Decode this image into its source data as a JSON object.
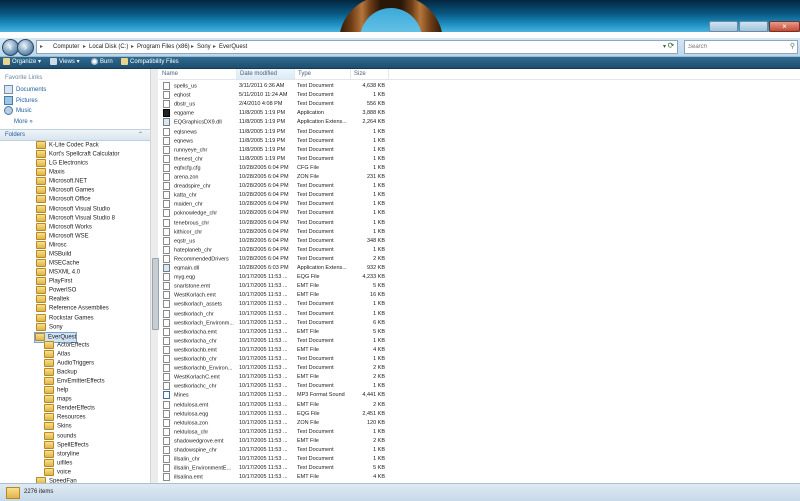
{
  "address": {
    "crumbs": [
      "Computer",
      "Local Disk (C:)",
      "Program Files (x86)",
      "Sony",
      "EverQuest"
    ],
    "search_placeholder": "Search"
  },
  "toolbar": {
    "organize": "Organize",
    "views": "Views",
    "burn": "Burn",
    "compat": "Compatibility Files"
  },
  "favorites": {
    "title": "Favorite Links",
    "items": [
      "Documents",
      "Pictures",
      "Music"
    ],
    "more": "More"
  },
  "folders": {
    "title": "Folders",
    "items": [
      "K-Lite Codec Pack",
      "Kort's Spellcraft Calculator",
      "LG Electronics",
      "Maxis",
      "Microsoft.NET",
      "Microsoft Games",
      "Microsoft Office",
      "Microsoft Visual Studio",
      "Microsoft Visual Studio 8",
      "Microsoft Works",
      "Microsoft WSE",
      "Mirosc",
      "MSBuild",
      "MSECache",
      "MSXML 4.0",
      "PlayFirst",
      "PowerISO",
      "Realtek",
      "Reference Assemblies",
      "Rockstar Games",
      "Sony",
      "EverQuest",
      "ActorEffects",
      "Atlas",
      "AudioTriggers",
      "Backup",
      "EnvEmitterEffects",
      "help",
      "maps",
      "RenderEffects",
      "Resources",
      "Skins",
      "sounds",
      "SpellEffects",
      "storyline",
      "uifiles",
      "voice",
      "SpeedFan"
    ]
  },
  "columns": {
    "name": "Name",
    "date": "Date modified",
    "type": "Type",
    "size": "Size"
  },
  "files": [
    {
      "name": "spells_us",
      "date": "3/11/2011 6:36 AM",
      "type": "Text Document",
      "size": "4,638 KB",
      "icon": "doc"
    },
    {
      "name": "eqhost",
      "date": "5/11/2010 11:24 AM",
      "type": "Text Document",
      "size": "1 KB",
      "icon": "doc"
    },
    {
      "name": "dbstr_us",
      "date": "2/4/2010 4:08 PM",
      "type": "Text Document",
      "size": "556 KB",
      "icon": "doc"
    },
    {
      "name": "eqgame",
      "date": "11/8/2005 1:19 PM",
      "type": "Application",
      "size": "3,888 KB",
      "icon": "app"
    },
    {
      "name": "EQGraphicsDX9.dll",
      "date": "11/8/2005 1:19 PM",
      "type": "Application Extens...",
      "size": "2,264 KB",
      "icon": "dll"
    },
    {
      "name": "eqlsnews",
      "date": "11/8/2005 1:19 PM",
      "type": "Text Document",
      "size": "1 KB",
      "icon": "doc"
    },
    {
      "name": "eqnews",
      "date": "11/8/2005 1:19 PM",
      "type": "Text Document",
      "size": "1 KB",
      "icon": "doc"
    },
    {
      "name": "runnyeye_chr",
      "date": "11/8/2005 1:19 PM",
      "type": "Text Document",
      "size": "1 KB",
      "icon": "doc"
    },
    {
      "name": "thenest_chr",
      "date": "11/8/2005 1:19 PM",
      "type": "Text Document",
      "size": "1 KB",
      "icon": "doc"
    },
    {
      "name": "eqfxcfg.cfg",
      "date": "10/28/2005 6:04 PM",
      "type": "CFG File",
      "size": "1 KB",
      "icon": "doc"
    },
    {
      "name": "arena.zon",
      "date": "10/28/2005 6:04 PM",
      "type": "ZON File",
      "size": "231 KB",
      "icon": "doc"
    },
    {
      "name": "dreadspire_chr",
      "date": "10/28/2005 6:04 PM",
      "type": "Text Document",
      "size": "1 KB",
      "icon": "doc"
    },
    {
      "name": "katta_chr",
      "date": "10/28/2005 6:04 PM",
      "type": "Text Document",
      "size": "1 KB",
      "icon": "doc"
    },
    {
      "name": "maiden_chr",
      "date": "10/28/2005 6:04 PM",
      "type": "Text Document",
      "size": "1 KB",
      "icon": "doc"
    },
    {
      "name": "poknowledge_chr",
      "date": "10/28/2005 6:04 PM",
      "type": "Text Document",
      "size": "1 KB",
      "icon": "doc"
    },
    {
      "name": "tenebrous_chr",
      "date": "10/28/2005 6:04 PM",
      "type": "Text Document",
      "size": "1 KB",
      "icon": "doc"
    },
    {
      "name": "kithicor_chr",
      "date": "10/28/2005 6:04 PM",
      "type": "Text Document",
      "size": "1 KB",
      "icon": "doc"
    },
    {
      "name": "eqstr_us",
      "date": "10/28/2005 6:04 PM",
      "type": "Text Document",
      "size": "348 KB",
      "icon": "doc"
    },
    {
      "name": "hateplaneb_chr",
      "date": "10/28/2005 6:04 PM",
      "type": "Text Document",
      "size": "1 KB",
      "icon": "doc"
    },
    {
      "name": "RecommendedDrivers",
      "date": "10/28/2005 6:04 PM",
      "type": "Text Document",
      "size": "2 KB",
      "icon": "doc"
    },
    {
      "name": "eqmain.dll",
      "date": "10/28/2005 6:03 PM",
      "type": "Application Extens...",
      "size": "932 KB",
      "icon": "dll"
    },
    {
      "name": "myg.eqg",
      "date": "10/17/2005 11:53 ...",
      "type": "EQG File",
      "size": "4,233 KB",
      "icon": "doc"
    },
    {
      "name": "snarlstone.emt",
      "date": "10/17/2005 11:53 ...",
      "type": "EMT File",
      "size": "5 KB",
      "icon": "doc"
    },
    {
      "name": "WestKorlach.emt",
      "date": "10/17/2005 11:53 ...",
      "type": "EMT File",
      "size": "16 KB",
      "icon": "doc"
    },
    {
      "name": "westkorlach_assets",
      "date": "10/17/2005 11:53 ...",
      "type": "Text Document",
      "size": "1 KB",
      "icon": "doc"
    },
    {
      "name": "westkorlach_chr",
      "date": "10/17/2005 11:53 ...",
      "type": "Text Document",
      "size": "1 KB",
      "icon": "doc"
    },
    {
      "name": "westkorlach_Environm...",
      "date": "10/17/2005 11:53 ...",
      "type": "Text Document",
      "size": "6 KB",
      "icon": "doc"
    },
    {
      "name": "westkorlacha.emt",
      "date": "10/17/2005 11:53 ...",
      "type": "EMT File",
      "size": "5 KB",
      "icon": "doc"
    },
    {
      "name": "westkorlacha_chr",
      "date": "10/17/2005 11:53 ...",
      "type": "Text Document",
      "size": "1 KB",
      "icon": "doc"
    },
    {
      "name": "westkorlachb.emt",
      "date": "10/17/2005 11:53 ...",
      "type": "EMT File",
      "size": "4 KB",
      "icon": "doc"
    },
    {
      "name": "westkorlachb_chr",
      "date": "10/17/2005 11:53 ...",
      "type": "Text Document",
      "size": "1 KB",
      "icon": "doc"
    },
    {
      "name": "westkorlachb_Environ...",
      "date": "10/17/2005 11:53 ...",
      "type": "Text Document",
      "size": "2 KB",
      "icon": "doc"
    },
    {
      "name": "WestKorlachC.emt",
      "date": "10/17/2005 11:53 ...",
      "type": "EMT File",
      "size": "2 KB",
      "icon": "doc"
    },
    {
      "name": "westkorlachc_chr",
      "date": "10/17/2005 11:53 ...",
      "type": "Text Document",
      "size": "1 KB",
      "icon": "doc"
    },
    {
      "name": "Mines",
      "date": "10/17/2005 11:53 ...",
      "type": "MP3 Format Sound",
      "size": "4,441 KB",
      "icon": "snd"
    },
    {
      "name": "nektulosa.emt",
      "date": "10/17/2005 11:53 ...",
      "type": "EMT File",
      "size": "2 KB",
      "icon": "doc"
    },
    {
      "name": "nektulosa.eqg",
      "date": "10/17/2005 11:53 ...",
      "type": "EQG File",
      "size": "2,451 KB",
      "icon": "doc"
    },
    {
      "name": "nektulosa.zon",
      "date": "10/17/2005 11:53 ...",
      "type": "ZON File",
      "size": "120 KB",
      "icon": "doc"
    },
    {
      "name": "nektulosa_chr",
      "date": "10/17/2005 11:53 ...",
      "type": "Text Document",
      "size": "1 KB",
      "icon": "doc"
    },
    {
      "name": "shadowedgrove.emt",
      "date": "10/17/2005 11:53 ...",
      "type": "EMT File",
      "size": "2 KB",
      "icon": "doc"
    },
    {
      "name": "shadowspine_chr",
      "date": "10/17/2005 11:53 ...",
      "type": "Text Document",
      "size": "1 KB",
      "icon": "doc"
    },
    {
      "name": "illsalin_chr",
      "date": "10/17/2005 11:53 ...",
      "type": "Text Document",
      "size": "1 KB",
      "icon": "doc"
    },
    {
      "name": "illsalin_EnvironmentE...",
      "date": "10/17/2005 11:53 ...",
      "type": "Text Document",
      "size": "5 KB",
      "icon": "doc"
    },
    {
      "name": "illsalina.emt",
      "date": "10/17/2005 11:53 ...",
      "type": "EMT File",
      "size": "4 KB",
      "icon": "doc"
    }
  ],
  "status": {
    "count": "2276 items"
  }
}
